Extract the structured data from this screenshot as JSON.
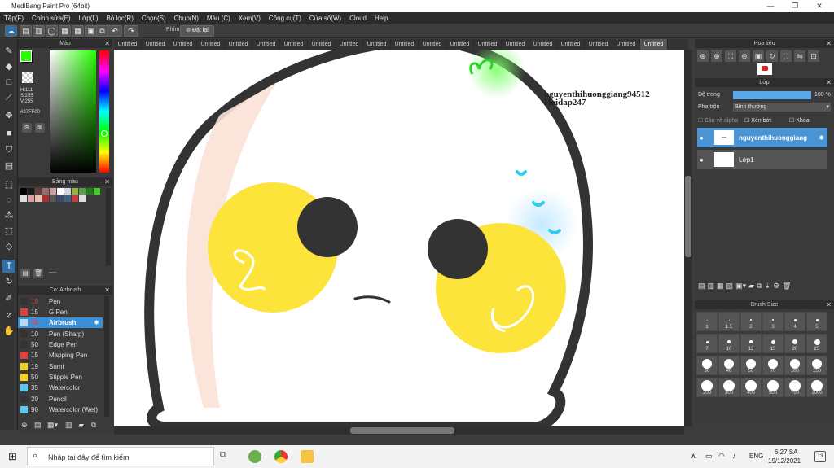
{
  "window": {
    "title": "MediBang Paint Pro (64bit)",
    "controls": [
      "—",
      "❐",
      "✕"
    ]
  },
  "menu": [
    "Tệp(F)",
    "Chỉnh sửa(E)",
    "Lớp(L)",
    "Bộ lọc(R)",
    "Chọn(S)",
    "Chụp(N)",
    "Màu (C)",
    "Xem(V)",
    "Công cụ(T)",
    "Cửa sổ(W)",
    "Cloud",
    "Help"
  ],
  "command_bar": {
    "phim_label": "Phím",
    "reset_label": "Đặt lại"
  },
  "tabs": [
    "Untitled",
    "Untitled",
    "Untitled",
    "Untitled",
    "Untitled",
    "Untitled",
    "Untitled",
    "Untitled",
    "Untitled",
    "Untitled",
    "Untitled",
    "Untitled",
    "Untitled",
    "Untitled",
    "Untitled",
    "Untitled",
    "Untitled",
    "Untitled",
    "Untitled",
    "Untitled"
  ],
  "color_panel": {
    "title": "Màu",
    "h": "H:111",
    "s": "S:255",
    "v": "V:255",
    "hex": "#27FF00",
    "fg": "#27ff00",
    "bg": "#000000"
  },
  "palette_panel": {
    "title": "Bảng màu",
    "footer": "----",
    "swatches": [
      "#000000",
      "#1a1a1a",
      "#6b3a3a",
      "#9a6a6a",
      "#c9a0a0",
      "#ffffff",
      "#cfd4dc",
      "#9ab04a",
      "#5aa04a",
      "#1f7d1a",
      "#3fd020",
      "#dddddd",
      "#d7a0a0",
      "#f0c0b0",
      "#aa3030",
      "#5a5a5a",
      "#3a4a6a",
      "#406080",
      "#c04040",
      "#e0e0e0"
    ]
  },
  "brush_panel": {
    "title": "Cọ: Airbrush",
    "items": [
      {
        "size": "15",
        "name": "Pen",
        "color": "#333333"
      },
      {
        "size": "15",
        "name": "G Pen",
        "color": "#e04040"
      },
      {
        "size": "70",
        "name": "Airbrush",
        "color": "#b7d8f0"
      },
      {
        "size": "10",
        "name": "Pen (Sharp)",
        "color": "#333333"
      },
      {
        "size": "50",
        "name": "Edge Pen",
        "color": "#333333"
      },
      {
        "size": "15",
        "name": "Mapping Pen",
        "color": "#e04040"
      },
      {
        "size": "19",
        "name": "Sumi",
        "color": "#f5d020"
      },
      {
        "size": "50",
        "name": "Stipple Pen",
        "color": "#f5d020"
      },
      {
        "size": "35",
        "name": "Watercolor",
        "color": "#5ac8f0"
      },
      {
        "size": "20",
        "name": "Pencil",
        "color": "#333333"
      },
      {
        "size": "90",
        "name": "Watercolor (Wet)",
        "color": "#5ac8f0"
      }
    ]
  },
  "navigator": {
    "title": "Hoa tiêu"
  },
  "layer_panel": {
    "title": "Lớp",
    "opacity_label": "Độ trong",
    "opacity_value": "100 %",
    "opacity": 100,
    "blend_label": "Pha trộn",
    "blend_value": "Bình thường",
    "alpha_label": "Bảo vệ alpha",
    "clip_label": "Xén bớt",
    "lock_label": "Khóa",
    "layers": [
      {
        "name": "nguyenthihuonggiang"
      },
      {
        "name": "Lớp1"
      }
    ]
  },
  "brush_size_panel": {
    "title": "Brush Size",
    "sizes": [
      "1",
      "1.5",
      "2",
      "3",
      "4",
      "5",
      "7",
      "10",
      "12",
      "15",
      "20",
      "25",
      "30",
      "40",
      "50",
      "70",
      "100",
      "150",
      "200",
      "300",
      "400",
      "500",
      "700",
      "1000"
    ]
  },
  "canvas_text": {
    "line1": "nguyenthihuonggiang94512",
    "line2": "Hoidap247"
  },
  "taskbar": {
    "search_placeholder": "Nhập tại đây để tìm kiếm",
    "lang": "ENG",
    "time": "6:27 SA",
    "date": "19/12/2021",
    "notifications": "13"
  }
}
